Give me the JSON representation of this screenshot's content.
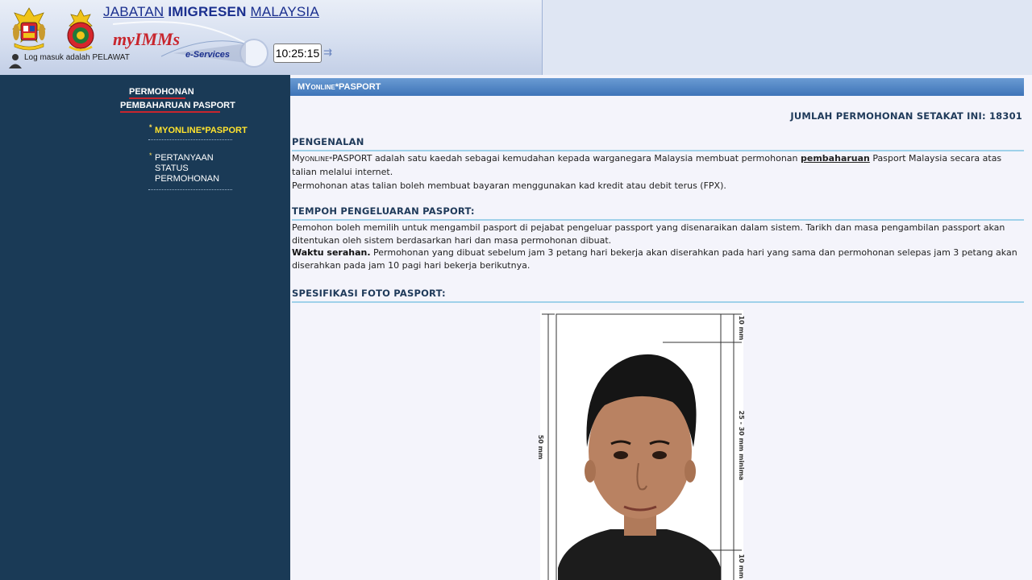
{
  "header": {
    "dept_prefix": "JABATAN",
    "dept_bold": "IMIGRESEN",
    "dept_suffix": "MALAYSIA",
    "brand": "myIMMs",
    "brand_sub": "e-Services",
    "clock": "10:25:15",
    "login_status": "Log masuk adalah PELAWAT"
  },
  "sidebar": {
    "heading_1": "PERMOHONAN",
    "heading_2": "PEMBAHARUAN PASPORT",
    "items": [
      {
        "label": "MYONLINE*PASPORT",
        "active": true
      },
      {
        "label_lines": [
          "PERTANYAAN",
          "STATUS",
          "PERMOHONAN"
        ],
        "active": false
      }
    ]
  },
  "main": {
    "title_prefix": "MY",
    "title_small": "ONLINE",
    "title_suffix": "*PASPORT",
    "counter_label": "JUMLAH PERMOHONAN SETAKAT INI:",
    "counter_value": "18301",
    "sections": {
      "intro": {
        "title": "PENGENALAN",
        "p1_pre": "PASPORT  adalah satu kaedah sebagai kemudahan kepada warganegara Malaysia membuat permohonan ",
        "p1_link": "pembaharuan",
        "p1_post": " Pasport Malaysia secara atas talian melalui internet.",
        "p1_prefix_my": "My",
        "p1_prefix_small": "ONLINE",
        "p1_prefix_star": "*",
        "p2": "Permohonan atas talian boleh membuat bayaran menggunakan kad kredit atau debit terus (FPX)."
      },
      "tempoh": {
        "title": "TEMPOH PENGELUARAN PASPORT:",
        "p1": "Pemohon boleh memilih untuk mengambil pasport di pejabat pengeluar passport yang disenaraikan dalam sistem. Tarikh dan masa pengambilan passport akan ditentukan oleh sistem berdasarkan hari dan masa permohonan dibuat.",
        "p2_bold": "Waktu serahan.",
        "p2": " Permohonan yang dibuat sebelum jam 3 petang hari bekerja akan diserahkan pada hari yang sama dan permohonan selepas jam 3 petang akan diserahkan pada jam 10 pagi hari bekerja berikutnya."
      },
      "foto": {
        "title": "SPESIFIKASI FOTO PASPORT:",
        "dim_top": "10 mm",
        "dim_height": "50 mm",
        "dim_face": "25 - 30 mm minima",
        "dim_bottom": "10 mm"
      }
    }
  },
  "colors": {
    "sidebar_bg": "#1a3a56",
    "title_bar": "#4a80c0",
    "section_rule": "#9fd1ea",
    "active_item": "#ffe32e",
    "brand_red": "#c8262e"
  }
}
